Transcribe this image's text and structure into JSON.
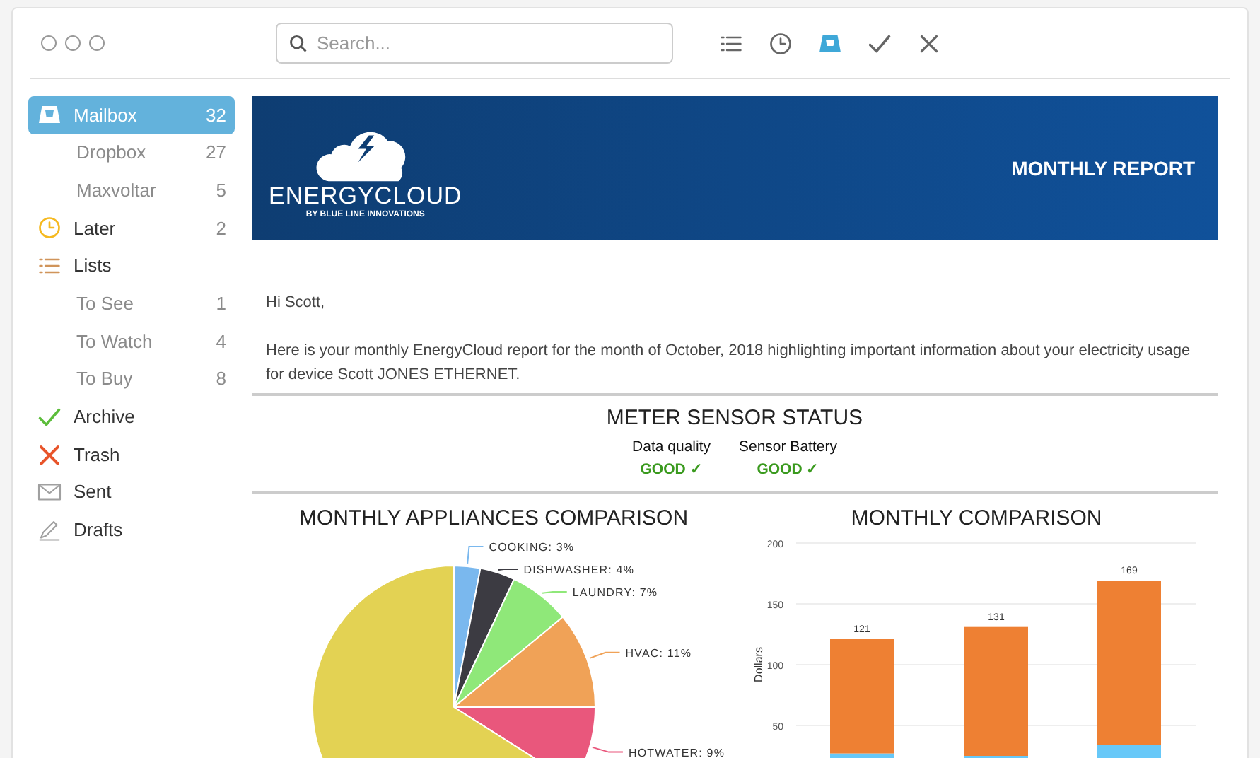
{
  "search": {
    "placeholder": "Search..."
  },
  "toolbar": [
    {
      "kind": "list",
      "color": "#666666"
    },
    {
      "kind": "clock",
      "color": "#666666"
    },
    {
      "kind": "mailbox",
      "color": "#3fa8d8"
    },
    {
      "kind": "check",
      "color": "#666666"
    },
    {
      "kind": "close",
      "color": "#666666"
    }
  ],
  "sidebar": {
    "items": [
      {
        "kind": "mailbox",
        "label": "Mailbox",
        "count": "32",
        "selected": true,
        "children": [
          {
            "label": "Dropbox",
            "count": "27",
            "selected": false
          },
          {
            "label": "Maxvoltar",
            "count": "5",
            "selected": false
          }
        ]
      },
      {
        "kind": "clock",
        "label": "Later",
        "count": "2",
        "selected": false
      },
      {
        "kind": "list",
        "label": "Lists",
        "selected": false,
        "children": [
          {
            "label": "To See",
            "count": "1",
            "selected": false
          },
          {
            "label": "To Watch",
            "count": "4",
            "selected": false
          },
          {
            "label": "To Buy",
            "count": "8",
            "selected": false
          }
        ]
      },
      {
        "kind": "check",
        "label": "Archive",
        "selected": false
      },
      {
        "kind": "trash",
        "label": "Trash",
        "selected": false
      },
      {
        "kind": "sent",
        "label": "Sent",
        "selected": false
      },
      {
        "kind": "draft",
        "label": "Drafts",
        "selected": false
      }
    ]
  },
  "email": {
    "banner": {
      "logo_name": "ENERGYCLOUD",
      "logo_tagline": "BY BLUE LINE INNOVATIONS",
      "title": "MONTHLY REPORT"
    },
    "greeting": "Hi Scott,",
    "body": "Here is your monthly EnergyCloud report for the month of October, 2018 highlighting important information about your electricity usage for device Scott JONES ETHERNET.",
    "status": {
      "title": "METER SENSOR STATUS",
      "items": [
        {
          "label": "Data quality",
          "value": "GOOD ✓"
        },
        {
          "label": "Sensor Battery",
          "value": "GOOD ✓"
        }
      ]
    },
    "appliances": {
      "title": "MONTHLY APPLIANCES COMPARISON",
      "chart_data": {
        "type": "pie",
        "categories": [
          "COOKING: 3%",
          "DISHWASHER: 4%",
          "LAUNDRY: 7%",
          "HVAC: 11%",
          "HOTWATER: 9%",
          null
        ],
        "series": [
          {
            "values": [
              3,
              4,
              7,
              11,
              9,
              66
            ],
            "colors": [
              "#7ab8ee",
              "#3c3b42",
              "#8fe879",
              "#f0a257",
              "#e9577c",
              "#e3d253"
            ]
          }
        ]
      }
    },
    "comparison": {
      "title": "MONTHLY COMPARISON",
      "chart_data": {
        "type": "bar",
        "stacked": true,
        "grid": true,
        "ylabel": "Dollars",
        "ylim": [
          0,
          200
        ],
        "yticks": [
          50,
          100,
          150,
          200
        ],
        "categories": [
          null,
          null,
          null
        ],
        "series": [
          {
            "color": "#67c8f8",
            "values": [
              27,
              25,
              34
            ]
          },
          {
            "color": "#ee8033",
            "values": [
              94,
              106,
              135
            ]
          }
        ],
        "value_labels": [
          "121",
          "131",
          "169"
        ]
      }
    }
  }
}
